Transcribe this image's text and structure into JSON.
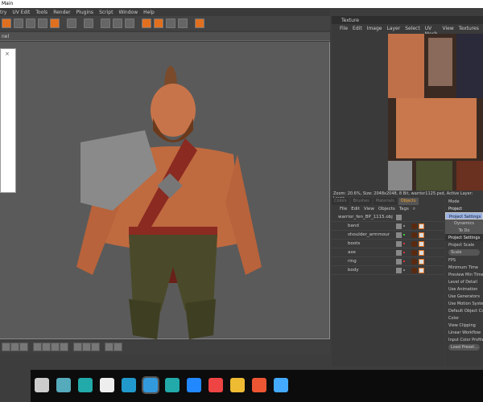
{
  "window": {
    "title": "Main"
  },
  "menu": [
    "try",
    "UV Edit",
    "Tools",
    "Render",
    "Plugins",
    "Script",
    "Window",
    "Help"
  ],
  "viewport": {
    "header": "nel",
    "close_label": "×"
  },
  "texture": {
    "title": "Texture",
    "menu": [
      "File",
      "Edit",
      "Image",
      "Layer",
      "Select",
      "UV Mesh",
      "View",
      "Textures"
    ],
    "status": "Zoom: 20.6%, Size: 2048x2048, 8 Bit, warrior1125.psd, Active Layer: Layer"
  },
  "objects": {
    "tabs": [
      "Colors",
      "Brushes",
      "Materials",
      "Objects"
    ],
    "active_tab": "Objects",
    "menu": [
      "File",
      "Edit",
      "View",
      "Objects",
      "Tags"
    ],
    "root": "warrior_fen_BP_1115.obj",
    "items": [
      {
        "name": "band",
        "dot": "#888"
      },
      {
        "name": "shoulder_armmour",
        "dot": "#3c3"
      },
      {
        "name": "boots",
        "dot": "#d33"
      },
      {
        "name": "axe",
        "dot": "#d33"
      },
      {
        "name": "ring",
        "dot": "#d33"
      },
      {
        "name": "body",
        "dot": "#888"
      }
    ]
  },
  "attributes": {
    "mode": "Mode",
    "project": "Project",
    "tabs": [
      "Project Settings",
      "Dynamics",
      "To Do"
    ],
    "section": "Project Settings",
    "fields": [
      "Project Scale",
      "Scale",
      "FPS",
      "Minimum Time",
      "Preview Min Time",
      "Level of Detail",
      "Use Animation",
      "Use Generators",
      "Use Motion System",
      "Default Object Color",
      "Color",
      "View Clipping",
      "Linear Workflow",
      "Input Color Profile"
    ],
    "load_preset": "Load Preset..."
  },
  "taskbar": {
    "icons": [
      "task-view",
      "notes",
      "3ds-max",
      "zbrush",
      "photoshop",
      "cinema4d",
      "substance",
      "edge",
      "chrome",
      "file-explorer",
      "ccleaner",
      "media-player"
    ]
  }
}
